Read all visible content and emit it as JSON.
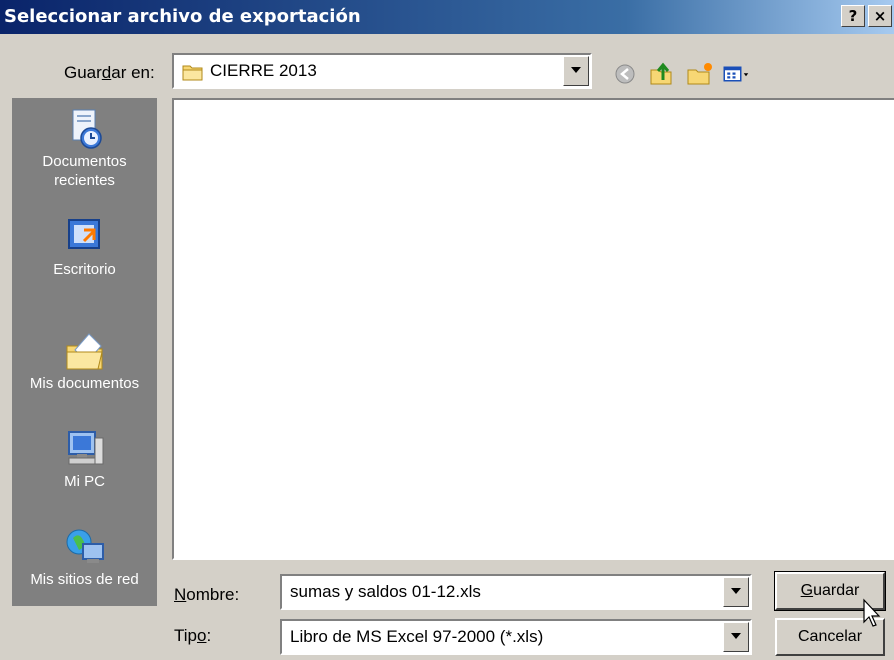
{
  "window": {
    "title": "Seleccionar archivo de exportación",
    "help_label": "?",
    "close_label": "×"
  },
  "save_in": {
    "label_pre": "Guar",
    "label_key": "d",
    "label_post": "ar en:",
    "value": "CIERRE 2013"
  },
  "places": [
    {
      "label": "Documentos recientes",
      "icon": "recent-documents-icon"
    },
    {
      "label": "Escritorio",
      "icon": "desktop-icon"
    },
    {
      "label": "Mis documentos",
      "icon": "my-documents-icon"
    },
    {
      "label": "Mi PC",
      "icon": "my-computer-icon"
    },
    {
      "label": "Mis sitios de red",
      "icon": "network-places-icon"
    }
  ],
  "filename": {
    "label_key": "N",
    "label_post": "ombre:",
    "value": "sumas y saldos 01-12.xls"
  },
  "filetype": {
    "label_pre": "Tip",
    "label_key": "o",
    "label_post": ":",
    "value": "Libro de MS Excel 97-2000 (*.xls)"
  },
  "buttons": {
    "save_key": "G",
    "save_post": "uardar",
    "cancel": "Cancelar"
  },
  "colors": {
    "titlebar_start": "#0a246a",
    "titlebar_end": "#a6caf0",
    "places_bg": "#808080",
    "dialog_bg": "#d4d0c8"
  }
}
